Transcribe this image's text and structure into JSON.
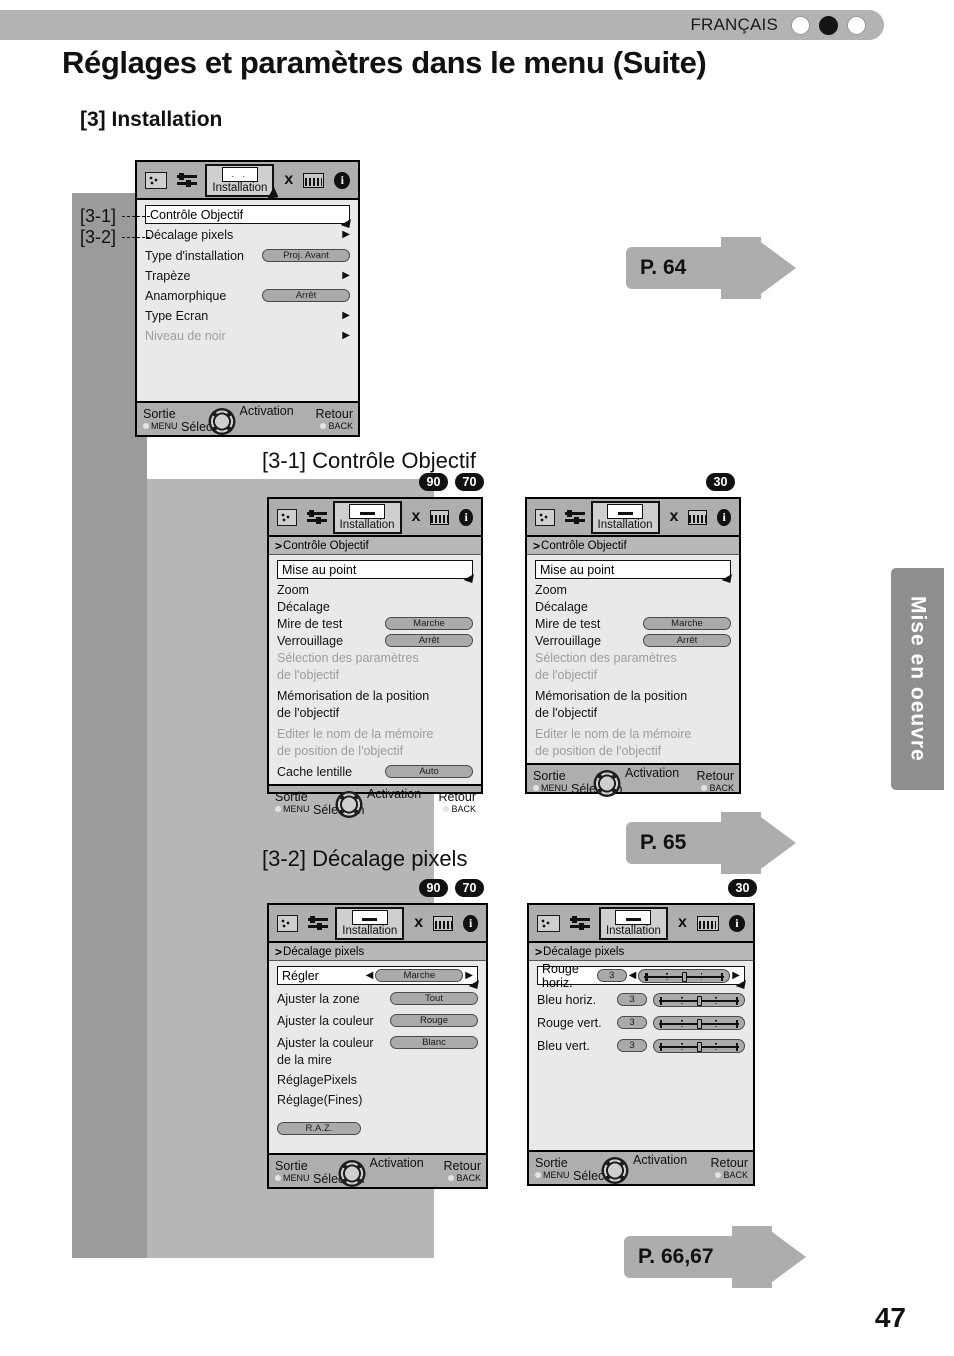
{
  "header": {
    "language": "FRANÇAIS",
    "indicator_dots": [
      "empty",
      "filled",
      "empty"
    ]
  },
  "page_title": "Réglages et paramètres dans le menu (Suite)",
  "section_title": "[3] Installation",
  "side_tab": "Mise en oeuvre",
  "page_number": "47",
  "icon_bar": {
    "picture_icon": "picture-icon",
    "slider_icon": "slider-icon",
    "tab_label": "Installation",
    "wrench_icon": "wrench-icon",
    "keyboard_icon": "keyboard-icon",
    "info_icon": "info-icon"
  },
  "nav_bar": {
    "exit": "Sortie",
    "menu": "MENU",
    "selection": "Sélection",
    "activation": "Activation",
    "back_label": "Retour",
    "back": "BACK"
  },
  "callouts": {
    "ref_3_1": "[3-1]",
    "ref_3_2": "[3-2]",
    "heading_3_1": "[3-1] Contrôle Objectif",
    "heading_3_2": "[3-2] Décalage pixels",
    "arrow_p64": "P. 64",
    "arrow_p65": "P. 65",
    "arrow_p6667": "P. 66,67"
  },
  "badges": {
    "left_3_1": [
      "90",
      "70"
    ],
    "right_3_1": [
      "30"
    ],
    "left_3_2": [
      "90",
      "70"
    ],
    "right_3_2": [
      "30"
    ]
  },
  "menu_installation": {
    "sub_title": "",
    "items": [
      {
        "label": "Contrôle Objectif",
        "type": "selected",
        "value": "",
        "dim": false
      },
      {
        "label": "Décalage pixels",
        "type": "arrow",
        "value": "",
        "dim": false
      },
      {
        "label": "Type d'installation",
        "type": "pill",
        "value": "Proj. Avant",
        "dim": false
      },
      {
        "label": "Trapèze",
        "type": "arrow",
        "value": "",
        "dim": false
      },
      {
        "label": "Anamorphique",
        "type": "pill",
        "value": "Arrêt",
        "dim": false
      },
      {
        "label": "Type Ecran",
        "type": "arrow",
        "value": "",
        "dim": false
      },
      {
        "label": "Niveau de noir",
        "type": "arrow",
        "value": "",
        "dim": true
      }
    ]
  },
  "menu_lens_left": {
    "sub_title": "Contrôle Objectif",
    "items": [
      {
        "label": "Mise au point",
        "type": "selected",
        "value": "",
        "dim": false
      },
      {
        "label": "Zoom",
        "type": "plain",
        "value": "",
        "dim": false
      },
      {
        "label": "Décalage",
        "type": "plain",
        "value": "",
        "dim": false
      },
      {
        "label": "Mire de test",
        "type": "pill",
        "value": "Marche",
        "dim": false
      },
      {
        "label": "Verrouillage",
        "type": "pill",
        "value": "Arrêt",
        "dim": false
      },
      {
        "label": "Sélection des paramètres",
        "type": "plain",
        "value": "",
        "dim": true
      },
      {
        "label": "de l'objectif",
        "type": "plain",
        "value": "",
        "dim": true
      },
      {
        "label": "Mémorisation de la position",
        "type": "plain",
        "value": "",
        "dim": false
      },
      {
        "label": "de l'objectif",
        "type": "plain",
        "value": "",
        "dim": false
      },
      {
        "label": "Editer le nom de la mémoire",
        "type": "plain",
        "value": "",
        "dim": true
      },
      {
        "label": "de position de l'objectif",
        "type": "plain",
        "value": "",
        "dim": true
      },
      {
        "label": "Cache lentille",
        "type": "pill",
        "value": "Auto",
        "dim": false
      }
    ]
  },
  "menu_lens_right": {
    "sub_title": "Contrôle Objectif",
    "items": [
      {
        "label": "Mise au point",
        "type": "selected",
        "value": "",
        "dim": false
      },
      {
        "label": "Zoom",
        "type": "plain",
        "value": "",
        "dim": false
      },
      {
        "label": "Décalage",
        "type": "plain",
        "value": "",
        "dim": false
      },
      {
        "label": "Mire de test",
        "type": "pill",
        "value": "Marche",
        "dim": false
      },
      {
        "label": "Verrouillage",
        "type": "pill",
        "value": "Arrêt",
        "dim": false
      },
      {
        "label": "Sélection des paramètres",
        "type": "plain",
        "value": "",
        "dim": true
      },
      {
        "label": "de l'objectif",
        "type": "plain",
        "value": "",
        "dim": true
      },
      {
        "label": "Mémorisation de la position",
        "type": "plain",
        "value": "",
        "dim": false
      },
      {
        "label": "de l'objectif",
        "type": "plain",
        "value": "",
        "dim": false
      },
      {
        "label": "Editer le nom de la mémoire",
        "type": "plain",
        "value": "",
        "dim": true
      },
      {
        "label": "de position de l'objectif",
        "type": "plain",
        "value": "",
        "dim": true
      }
    ]
  },
  "menu_pixel_left": {
    "sub_title": "Décalage pixels",
    "items": [
      {
        "label": "Régler",
        "type": "selected-pill",
        "value": "Marche",
        "dim": false
      },
      {
        "label": "Ajuster la zone",
        "type": "pill",
        "value": "Tout",
        "dim": false
      },
      {
        "label": "Ajuster la couleur",
        "type": "pill",
        "value": "Rouge",
        "dim": false
      },
      {
        "label": "Ajuster la couleur",
        "type": "pill",
        "value": "Blanc",
        "dim": false
      },
      {
        "label": "de la mire",
        "type": "plain",
        "value": "",
        "dim": false
      },
      {
        "label": "RéglagePixels",
        "type": "plain",
        "value": "",
        "dim": false
      },
      {
        "label": "Réglage(Fines)",
        "type": "plain",
        "value": "",
        "dim": false
      }
    ],
    "reset_label": "R.A.Z."
  },
  "menu_pixel_right": {
    "sub_title": "Décalage pixels",
    "items": [
      {
        "label": "Rouge horiz.",
        "value": "3",
        "type": "selected-slider",
        "dim": false
      },
      {
        "label": "Bleu horiz.",
        "value": "3",
        "type": "slider",
        "dim": false
      },
      {
        "label": "Rouge vert.",
        "value": "3",
        "type": "slider",
        "dim": false
      },
      {
        "label": "Bleu vert.",
        "value": "3",
        "type": "slider",
        "dim": false
      }
    ]
  },
  "colors": {
    "gray_dark": "#9b9b9b",
    "gray_light": "#b6b6b6",
    "osd_body": "#e9e9e9",
    "osd_bar": "#aeaeae",
    "arrow_gray": "#adadad",
    "side_tab": "#8f8f8f"
  }
}
